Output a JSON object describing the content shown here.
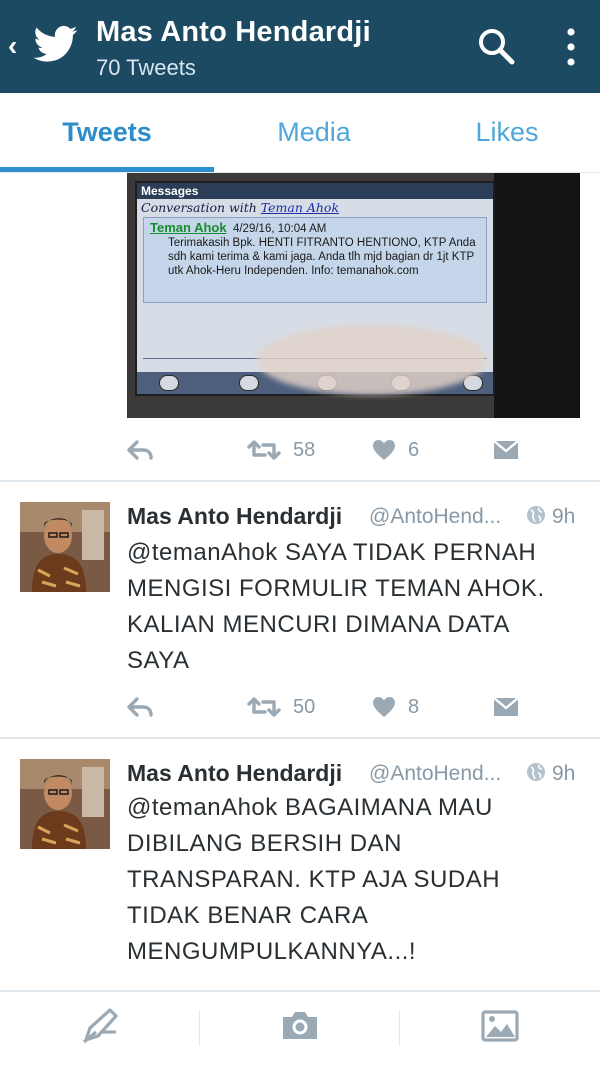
{
  "header": {
    "back_glyph": "‹",
    "name": "Mas Anto Hendardji",
    "tweet_count": "70 Tweets",
    "icons": [
      "twitter-bird-icon",
      "search-icon",
      "more-vertical-icon"
    ],
    "bg_color": "#1c4a63"
  },
  "tabs": {
    "items": [
      {
        "label": "Tweets",
        "selected": true
      },
      {
        "label": "Media",
        "selected": false
      },
      {
        "label": "Likes",
        "selected": false
      }
    ],
    "accent": "#2b8fd0"
  },
  "photo": {
    "screen_bar": "Messages",
    "conversation_prefix": "Conversation with ",
    "conversation_contact": "Teman Ahok",
    "sms_sender": "Teman Ahok",
    "sms_time": "4/29/16, 10:04 AM",
    "sms_body": "Terimakasih Bpk. HENTI FITRANTO HENTIONO, KTP Anda sdh kami terima & kami jaga. Anda tlh mjd bagian dr 1jt KTP utk Ahok-Heru Independen. Info: temanahok.com"
  },
  "first_actions": {
    "retweets": "58",
    "likes": "6"
  },
  "tweets": [
    {
      "name": "Mas Anto Hendardji",
      "handle": "@AntoHend...",
      "time": "9h",
      "text": "@temanAhok SAYA TIDAK PERNAH MENGISI FORMULIR TEMAN AHOK. KALIAN MENCURI DIMANA DATA SAYA",
      "retweets": "50",
      "likes": "8"
    },
    {
      "name": "Mas Anto Hendardji",
      "handle": "@AntoHend...",
      "time": "9h",
      "text": "@temanAhok BAGAIMANA MAU DIBILANG BERSIH DAN TRANSPARAN. KTP AJA SUDAH TIDAK BENAR CARA MENGUMPULKANNYA...!"
    }
  ],
  "bottom_bar": {
    "icons": [
      "compose-icon",
      "camera-icon",
      "image-icon"
    ]
  }
}
